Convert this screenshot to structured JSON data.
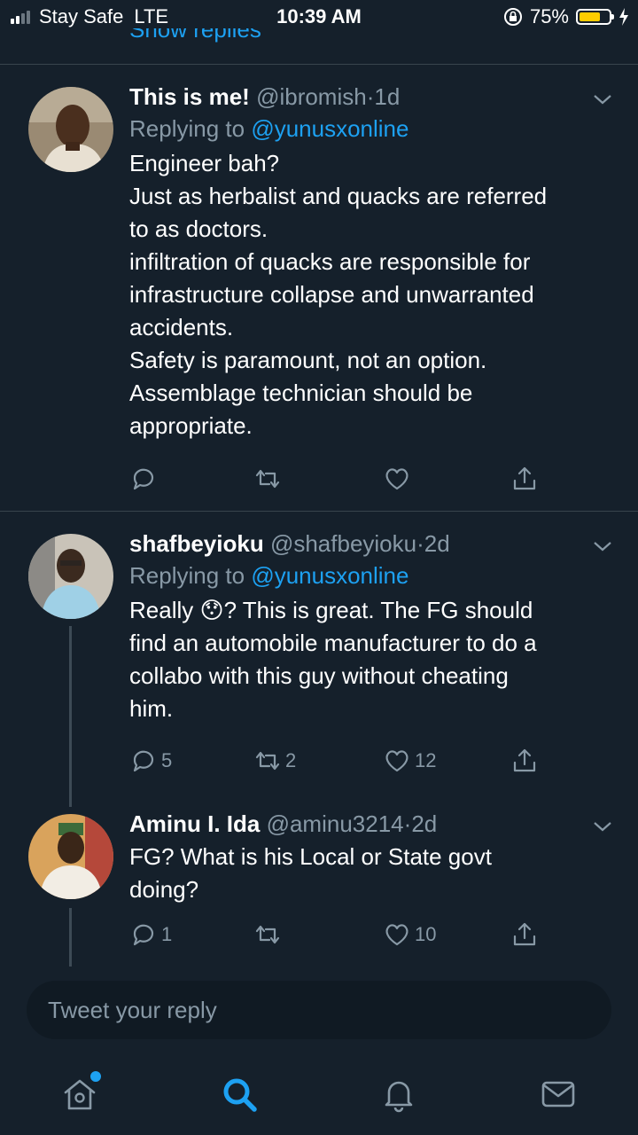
{
  "status_bar": {
    "carrier": "Stay Safe",
    "network": "LTE",
    "time": "10:39 AM",
    "battery_percent": "75%",
    "battery_level": 0.75,
    "battery_color": "#ffcc00"
  },
  "show_replies": "Show replies",
  "tweets": [
    {
      "name": "This is me!",
      "handle": "@ibromish",
      "dot": "·",
      "time": "1d",
      "replying_prefix": "Replying to",
      "replying_to": "@yunusxonline",
      "lines": [
        "Engineer bah?",
        "Just as herbalist and quacks are referred",
        "to as doctors.",
        "infiltration of quacks are responsible for",
        "infrastructure collapse and unwarranted",
        "accidents.",
        "Safety is paramount, not an option.",
        "Assemblage technician should be",
        "appropriate."
      ],
      "reply_count": "",
      "retweet_count": "",
      "like_count": ""
    },
    {
      "name": "shafbeyioku",
      "handle": "@shafbeyioku",
      "dot": "·",
      "time": "2d",
      "replying_prefix": "Replying to",
      "replying_to": "@yunusxonline",
      "lines": [
        "Really 😯? This is great. The FG should",
        "find an automobile manufacturer to do a",
        "collabo with this guy without cheating",
        "him."
      ],
      "reply_count": "5",
      "retweet_count": "2",
      "like_count": "12"
    },
    {
      "name": "Aminu I. Ida",
      "handle": "@aminu3214",
      "dot": "·",
      "time": "2d",
      "lines": [
        "FG? What is his Local or State govt",
        "doing?"
      ],
      "reply_count": "1",
      "retweet_count": "",
      "like_count": "10"
    }
  ],
  "composer": {
    "placeholder": "Tweet your reply"
  },
  "colors": {
    "accent": "#1da1f2",
    "background": "#15202b",
    "muted": "#8899a6"
  },
  "tab_bar": [
    "home-icon",
    "search-icon",
    "notifications-icon",
    "messages-icon"
  ]
}
